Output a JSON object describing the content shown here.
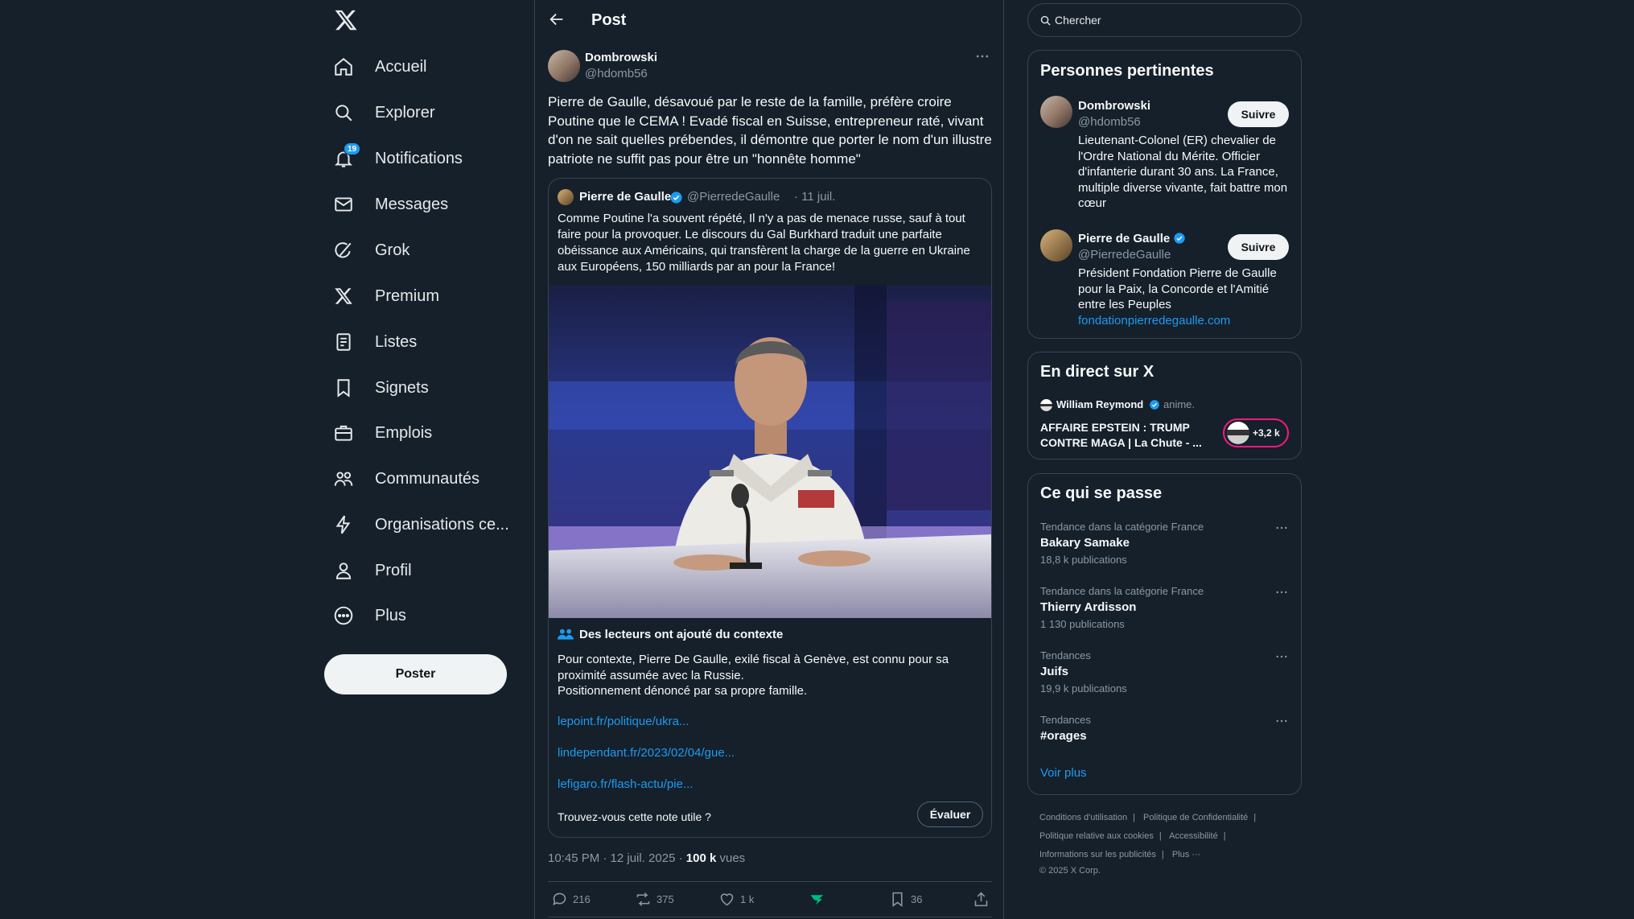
{
  "nav": {
    "items": [
      {
        "label": "Accueil",
        "icon": "home-icon"
      },
      {
        "label": "Explorer",
        "icon": "search-icon"
      },
      {
        "label": "Notifications",
        "icon": "bell-icon"
      },
      {
        "label": "Messages",
        "icon": "mail-icon"
      },
      {
        "label": "Grok",
        "icon": "grok-icon"
      },
      {
        "label": "Premium",
        "icon": "x-logo-icon"
      },
      {
        "label": "Listes",
        "icon": "list-icon"
      },
      {
        "label": "Signets",
        "icon": "bookmark-icon"
      },
      {
        "label": "Emplois",
        "icon": "briefcase-icon"
      },
      {
        "label": "Communautés",
        "icon": "people-icon"
      },
      {
        "label": "Organisations ce...",
        "icon": "lightning-icon"
      },
      {
        "label": "Profil",
        "icon": "person-icon"
      },
      {
        "label": "Plus",
        "icon": "more-circle-icon"
      }
    ],
    "notifications_badge": "19",
    "post_button": "Poster"
  },
  "header": {
    "title": "Post"
  },
  "post": {
    "author_name": "Dombrowski",
    "author_handle": "@hdomb56",
    "text": "Pierre de Gaulle, désavoué par le reste de la famille, préfère croire Poutine que le CEMA ! Evadé fiscal en Suisse, entrepreneur raté, vivant d'on ne sait quelles prébendes, il démontre que porter le nom d'un illustre patriote ne suffit pas pour être un \"honnête homme\"",
    "time": "10:45 PM · 12 juil. 2025 · ",
    "views_count": "100 k",
    "views_label": " vues",
    "actions": {
      "replies": "216",
      "reposts": "375",
      "likes": "1 k",
      "bookmarks": "36"
    }
  },
  "quote": {
    "name": "Pierre de Gaulle",
    "handle": "@PierredeGaulle",
    "date": "· 11 juil.",
    "text": "Comme Poutine l'a souvent répété, Il n'y a pas de menace russe, sauf à tout faire pour la provoquer. Le discours du Gal Burkhard traduit une parfaite obéissance aux Américains, qui transfèrent la charge de la guerre en Ukraine aux Européens, 150 milliards par an pour la France!"
  },
  "context_note": {
    "heading": "Des lecteurs ont ajouté du contexte",
    "body_line1": "Pour contexte, Pierre De Gaulle, exilé fiscal à Genève, est connu pour sa proximité assumée avec la Russie.",
    "body_line2": "Positionnement dénoncé par sa propre famille.",
    "links": [
      "lepoint.fr/politique/ukra...",
      "lindependant.fr/2023/02/04/gue...",
      "lefigaro.fr/flash-actu/pie..."
    ],
    "question": "Trouvez-vous cette note utile ?",
    "rate_button": "Évaluer"
  },
  "search": {
    "placeholder": "Chercher"
  },
  "people": {
    "title": "Personnes pertinentes",
    "list": [
      {
        "name": "Dombrowski",
        "handle": "@hdomb56",
        "follow": "Suivre",
        "bio": "Lieutenant-Colonel (ER) chevalier de l'Ordre National du Mérite. Officier d'infanterie durant 30 ans. La France, multiple diverse vivante, fait battre mon cœur",
        "link": ""
      },
      {
        "name": "Pierre de Gaulle",
        "handle": "@PierredeGaulle",
        "follow": "Suivre",
        "bio": "Président Fondation Pierre de Gaulle pour la Paix, la Concorde et l'Amitié entre les Peuples",
        "link": "fondationpierredegaulle.com"
      }
    ]
  },
  "live": {
    "title": "En direct sur X",
    "host": "William Reymond",
    "role": "anime.",
    "stream_title": "AFFAIRE EPSTEIN : TRUMP CONTRE MAGA | La Chute - ...",
    "listeners": "+3,2 k"
  },
  "trends": {
    "title": "Ce qui se passe",
    "items": [
      {
        "category": "Tendance dans la catégorie France",
        "name": "Bakary Samake",
        "count": "18,8 k publications"
      },
      {
        "category": "Tendance dans la catégorie France",
        "name": "Thierry Ardisson",
        "count": "1 130 publications"
      },
      {
        "category": "Tendances",
        "name": "Juifs",
        "count": "19,9 k publications"
      },
      {
        "category": "Tendances",
        "name": "#orages",
        "count": ""
      }
    ],
    "show_more": "Voir plus"
  },
  "footer": {
    "links": [
      "Conditions d'utilisation",
      "Politique de Confidentialité",
      "Politique relative aux cookies",
      "Accessibilité",
      "Informations sur les publicités",
      "Plus ···"
    ],
    "copyright": "© 2025 X Corp."
  },
  "colors": {
    "accent": "#1d9bf0",
    "background": "#15202b",
    "border": "#38444d",
    "muted": "#8b98a5",
    "live": "#f91880"
  }
}
